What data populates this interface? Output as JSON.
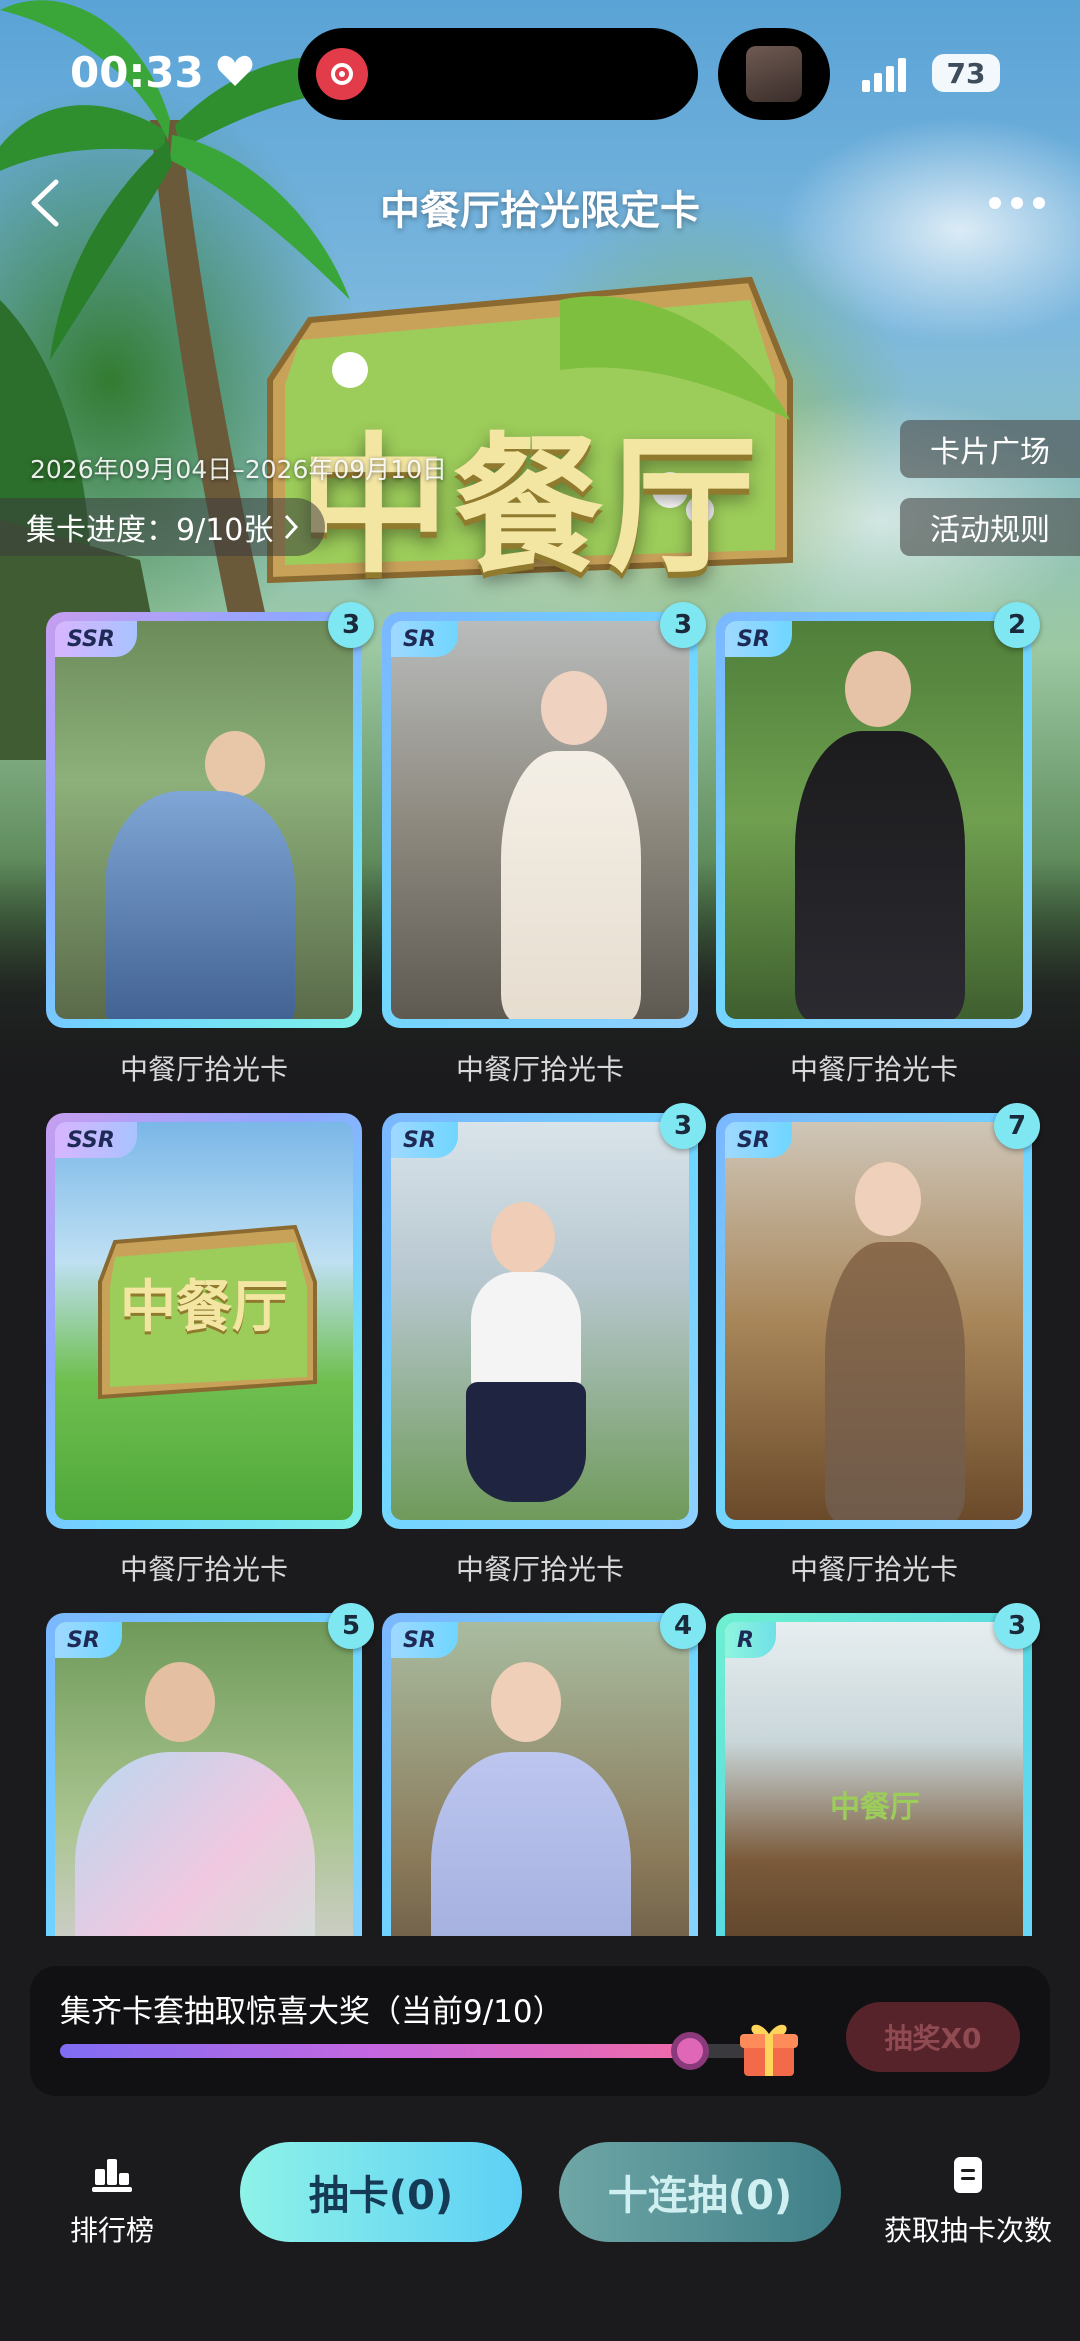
{
  "status_bar": {
    "time": "00:33",
    "battery": "73"
  },
  "header": {
    "title": "中餐厅拾光限定卡",
    "date_range": "2026年09月04日–2026年09月10日"
  },
  "collection": {
    "progress_label": "集卡进度：9/10张",
    "card_square_button": "卡片广场",
    "rules_button": "活动规则"
  },
  "cards": [
    {
      "rarity": "SSR",
      "count": "3",
      "name": "中餐厅拾光卡"
    },
    {
      "rarity": "SR",
      "count": "3",
      "name": "中餐厅拾光卡"
    },
    {
      "rarity": "SR",
      "count": "2",
      "name": "中餐厅拾光卡"
    },
    {
      "rarity": "SSR",
      "count": "",
      "name": "中餐厅拾光卡",
      "logo_text": "中餐厅"
    },
    {
      "rarity": "SR",
      "count": "3",
      "name": "中餐厅拾光卡"
    },
    {
      "rarity": "SR",
      "count": "7",
      "name": "中餐厅拾光卡"
    },
    {
      "rarity": "SR",
      "count": "5",
      "name": ""
    },
    {
      "rarity": "SR",
      "count": "4",
      "name": ""
    },
    {
      "rarity": "R",
      "count": "3",
      "name": "",
      "sign_text": "中餐厅"
    }
  ],
  "prize": {
    "text": "集齐卡套抽取惊喜大奖（当前9/10）",
    "progress": 0.9,
    "draw_button": "抽奖X0"
  },
  "bottom_nav": {
    "leaderboard": "排行榜",
    "draw_card": "抽卡(0)",
    "ten_draw": "十连抽(0)",
    "get_draws": "获取抽卡次数"
  },
  "hero_logo": "中餐厅",
  "colors": {
    "accent_cyan": "#6fd6ff",
    "progress_fill": "#c567e0",
    "draw_button_bg": "#57232a"
  }
}
